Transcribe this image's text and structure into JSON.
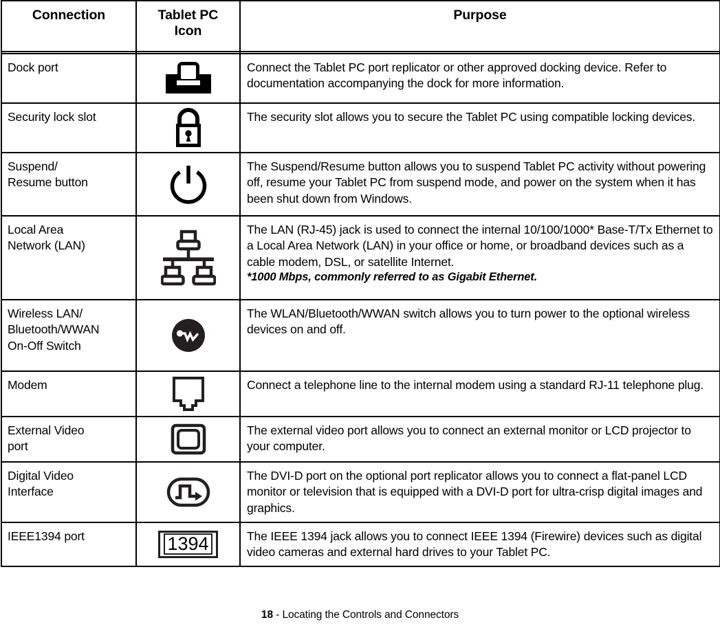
{
  "document": {
    "footer_page_number": "18",
    "footer_separator": " - ",
    "footer_title": "Locating the Controls and Connectors"
  },
  "table": {
    "headers": {
      "connection": "Connection",
      "icon_line1": "Tablet PC",
      "icon_line2": "Icon",
      "purpose": "Purpose"
    },
    "rows": [
      {
        "connection": "Dock port",
        "icon_name": "dock-port-icon",
        "purpose": "Connect the Tablet PC port replicator or other approved docking device. Refer to documentation accompanying the dock for more information.",
        "note": ""
      },
      {
        "connection": "Security lock slot",
        "icon_name": "padlock-icon",
        "purpose": "The security slot allows you to secure the Tablet PC using compatible locking devices.",
        "note": ""
      },
      {
        "connection": "Suspend/\nResume button",
        "icon_name": "power-button-icon",
        "purpose": "The Suspend/Resume button allows you to suspend Tablet PC activity without powering off, resume your Tablet PC from suspend mode, and power on the system when it has been shut down from Windows.",
        "note": ""
      },
      {
        "connection": "Local Area\nNetwork (LAN)",
        "icon_name": "lan-network-icon",
        "purpose": "The LAN (RJ-45) jack is used to connect the internal 10/100/1000* Base-T/Tx Ethernet to a Local Area Network (LAN) in your office or home, or broadband devices such as a cable modem, DSL, or satellite Internet.",
        "note": "*1000 Mbps, commonly referred to as Gigabit Ethernet."
      },
      {
        "connection": "Wireless LAN/\nBluetooth/WWAN\nOn-Off Switch",
        "icon_name": "wireless-switch-icon",
        "purpose": "The WLAN/Bluetooth/WWAN switch allows you to turn power to the optional wireless devices on and off.",
        "note": ""
      },
      {
        "connection": "Modem",
        "icon_name": "modem-jack-icon",
        "purpose": "Connect a telephone line to the internal modem using a standard RJ-11 telephone plug.",
        "note": ""
      },
      {
        "connection": "External Video\nport",
        "icon_name": "external-video-monitor-icon",
        "purpose": "The external video port allows you to connect an external monitor or LCD projector to your computer.",
        "note": ""
      },
      {
        "connection": "Digital Video\nInterface",
        "icon_name": "dvi-icon",
        "purpose": "The DVI-D port on the optional port replicator allows you to connect a flat-panel LCD monitor or television that is equipped with a DVI-D port for ultra-crisp digital images and graphics.",
        "note": ""
      },
      {
        "connection": "IEEE1394 port",
        "icon_name": "ieee1394-icon",
        "icon_text": "1394",
        "purpose": "The IEEE 1394 jack allows you to connect IEEE 1394 (Firewire) devices such as digital video cameras and external hard drives to your Tablet PC.",
        "note": ""
      }
    ]
  },
  "colors": {
    "ink": "#000000",
    "paper": "#ffffff",
    "icon_dark": "#231f20"
  }
}
